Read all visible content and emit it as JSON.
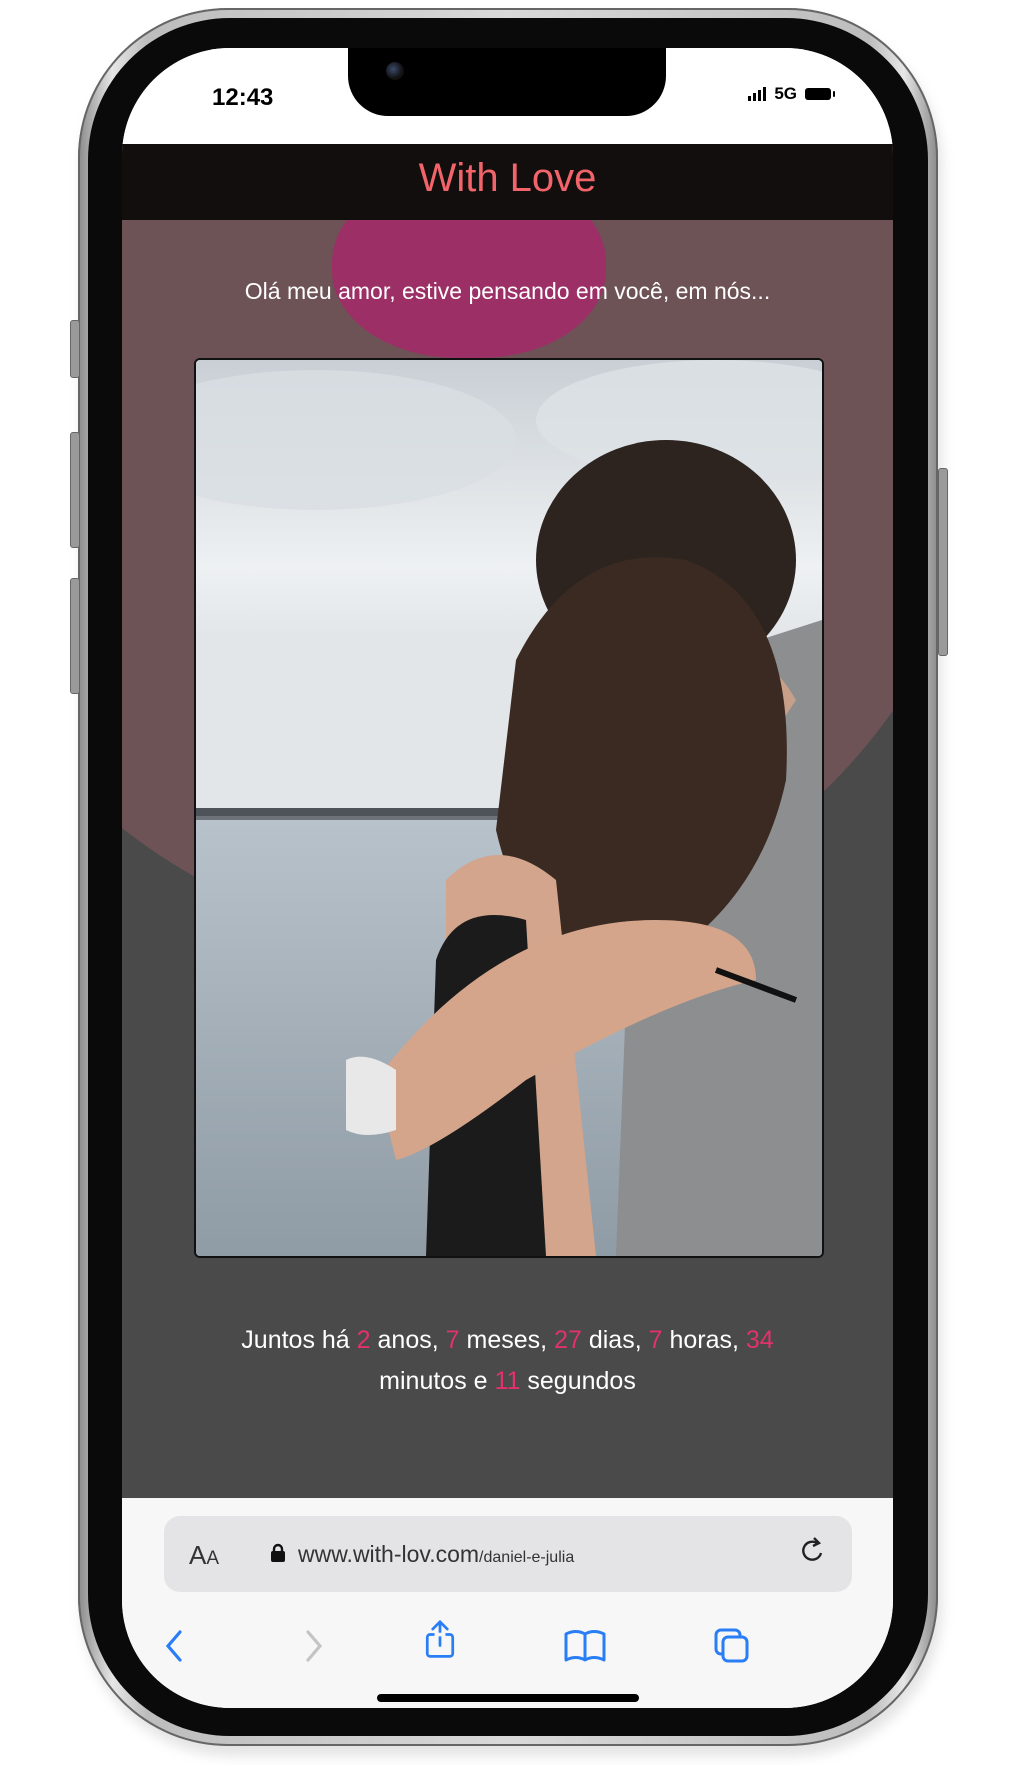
{
  "status_bar": {
    "time": "12:43",
    "network": "5G"
  },
  "header": {
    "title": "With Love"
  },
  "message": {
    "greeting": "Olá meu amor, estive pensando em você, em nós..."
  },
  "counter": {
    "prefix": "Juntos há",
    "years": "2",
    "years_label": "anos,",
    "months": "7",
    "months_label": "meses,",
    "days": "27",
    "days_label": "dias,",
    "hours": "7",
    "hours_label": "horas,",
    "minutes": "34",
    "minutes_label": "minutos e",
    "seconds": "11",
    "seconds_label": "segundos"
  },
  "browser": {
    "text_size": "AA",
    "url_domain": "www.with-lov.com",
    "url_path": "/daniel-e-julia",
    "icons": [
      "text-size-icon",
      "lock-icon",
      "reload-icon",
      "back-icon",
      "forward-icon",
      "share-icon",
      "bookmarks-icon",
      "tabs-icon"
    ]
  },
  "colors": {
    "title": "#f1646a",
    "highlight": "#e0326b",
    "header_bg": "#120e0e",
    "page_bg": "#4a4a4a",
    "blob": "#6e5356",
    "link_blue": "#2a7ef5"
  }
}
